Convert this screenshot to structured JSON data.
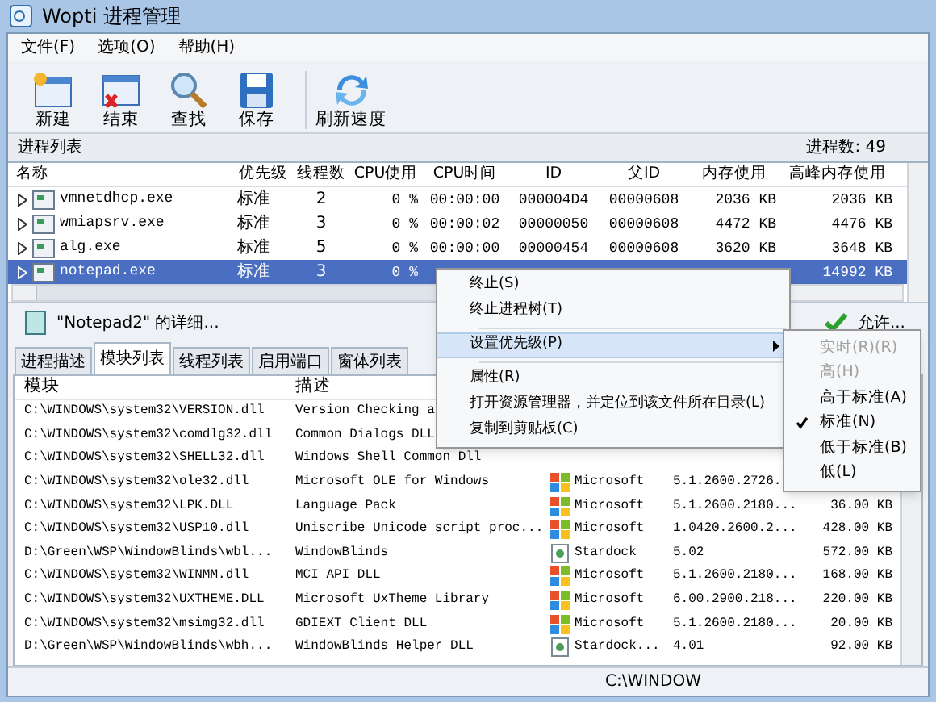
{
  "window": {
    "title": "Wopti 进程管理"
  },
  "menu": [
    "文件(F)",
    "选项(O)",
    "帮助(H)"
  ],
  "toolbar": [
    {
      "label": "新建",
      "kind": "new"
    },
    {
      "label": "结束",
      "kind": "end"
    },
    {
      "label": "查找",
      "kind": "find"
    },
    {
      "label": "保存",
      "kind": "save"
    },
    {
      "label": "刷新速度",
      "kind": "refresh"
    }
  ],
  "process_list": {
    "title": "进程列表",
    "count": "进程数: 49",
    "columns": [
      "名称",
      "优先级",
      "线程数",
      "CPU使用",
      "CPU时间",
      "ID",
      "父ID",
      "内存使用",
      "高峰内存使用"
    ],
    "rows": [
      {
        "name": "vmnetdhcp.exe",
        "priority": "标准",
        "threads": "2",
        "cpu": "0 %",
        "cpu_time": "00:00:00",
        "id": "000004D4",
        "parent_id": "00000608",
        "memory": "2036 KB",
        "peak_memory": "2036 KB",
        "selected": false
      },
      {
        "name": "wmiapsrv.exe",
        "priority": "标准",
        "threads": "3",
        "cpu": "0 %",
        "cpu_time": "00:00:02",
        "id": "00000050",
        "parent_id": "00000608",
        "memory": "4472 KB",
        "peak_memory": "4476 KB",
        "selected": false
      },
      {
        "name": "alg.exe",
        "priority": "标准",
        "threads": "5",
        "cpu": "0 %",
        "cpu_time": "00:00:00",
        "id": "00000454",
        "parent_id": "00000608",
        "memory": "3620 KB",
        "peak_memory": "3648 KB",
        "selected": false
      },
      {
        "name": "notepad.exe",
        "priority": "标准",
        "threads": "3",
        "cpu": "0 %",
        "peak_memory": "14992 KB",
        "selected": true
      }
    ]
  },
  "detail": {
    "title": "\"Notepad2\" 的详细...",
    "action": "允许..."
  },
  "tabs": [
    {
      "label": "进程描述",
      "selected": false
    },
    {
      "label": "模块列表",
      "selected": true
    },
    {
      "label": "线程列表",
      "selected": false
    },
    {
      "label": "启用端口",
      "selected": false
    },
    {
      "label": "窗体列表",
      "selected": false
    }
  ],
  "modules": {
    "columns": [
      "模块",
      "描述"
    ],
    "rows": [
      {
        "module": "C:\\WINDOWS\\system32\\VERSION.dll",
        "description": "Version Checking a"
      },
      {
        "module": "C:\\WINDOWS\\system32\\comdlg32.dll",
        "description": "Common Dialogs DLL"
      },
      {
        "module": "C:\\WINDOWS\\system32\\SHELL32.dll",
        "description": "Windows Shell Common Dll"
      },
      {
        "module": "C:\\WINDOWS\\system32\\ole32.dll",
        "description": "Microsoft OLE for Windows",
        "company": "Microsoft",
        "kind": "flag",
        "version": "5.1.2600.2726."
      },
      {
        "module": "C:\\WINDOWS\\system32\\LPK.DLL",
        "description": "Language Pack",
        "company": "Microsoft",
        "kind": "flag",
        "version": "5.1.2600.2180...",
        "size": "36.00 KB"
      },
      {
        "module": "C:\\WINDOWS\\system32\\USP10.dll",
        "description": "Uniscribe Unicode script proc...",
        "company": "Microsoft",
        "kind": "flag",
        "version": "1.0420.2600.2...",
        "size": "428.00 KB"
      },
      {
        "module": "D:\\Green\\WSP\\WindowBlinds\\wbl...",
        "description": "WindowBlinds",
        "company": "Stardock",
        "kind": "doc",
        "version": "5.02",
        "size": "572.00 KB"
      },
      {
        "module": "C:\\WINDOWS\\system32\\WINMM.dll",
        "description": "MCI API DLL",
        "company": "Microsoft",
        "kind": "flag",
        "version": "5.1.2600.2180...",
        "size": "168.00 KB"
      },
      {
        "module": "C:\\WINDOWS\\system32\\UXTHEME.DLL",
        "description": "Microsoft UxTheme Library",
        "company": "Microsoft",
        "kind": "flag",
        "version": "6.00.2900.218...",
        "size": "220.00 KB"
      },
      {
        "module": "C:\\WINDOWS\\system32\\msimg32.dll",
        "description": "GDIEXT Client DLL",
        "company": "Microsoft",
        "kind": "flag",
        "version": "5.1.2600.2180...",
        "size": "20.00 KB"
      },
      {
        "module": "D:\\Green\\WSP\\WindowBlinds\\wbh...",
        "description": "WindowBlinds Helper DLL",
        "company": "Stardock...",
        "kind": "doc",
        "version": "4.01",
        "size": "92.00 KB"
      }
    ]
  },
  "status_bar": {
    "path": "C:\\WINDOW"
  },
  "context_menu": {
    "items": [
      {
        "kind": "item",
        "label": "终止(S)",
        "highlighted": false
      },
      {
        "kind": "item",
        "label": "终止进程树(T)",
        "highlighted": false
      },
      {
        "kind": "separator"
      },
      {
        "kind": "item",
        "label": "设置优先级(P)",
        "highlighted": true,
        "has_submenu": true
      },
      {
        "kind": "separator"
      },
      {
        "kind": "item",
        "label": "属性(R)",
        "highlighted": false
      },
      {
        "kind": "item",
        "label": "打开资源管理器，并定位到该文件所在目录(L)",
        "highlighted": false
      },
      {
        "kind": "item",
        "label": "复制到剪贴板(C)",
        "highlighted": false
      }
    ]
  },
  "priority_submenu": {
    "items": [
      {
        "label": "实时(R)(R)",
        "disabled": true,
        "checked": false
      },
      {
        "label": "高(H)",
        "disabled": true,
        "checked": false
      },
      {
        "label": "高于标准(A)",
        "disabled": false,
        "checked": false
      },
      {
        "label": "标准(N)",
        "disabled": false,
        "checked": true
      },
      {
        "label": "低于标准(B)",
        "disabled": false,
        "checked": false
      },
      {
        "label": "低(L)",
        "disabled": false,
        "checked": false
      }
    ]
  }
}
